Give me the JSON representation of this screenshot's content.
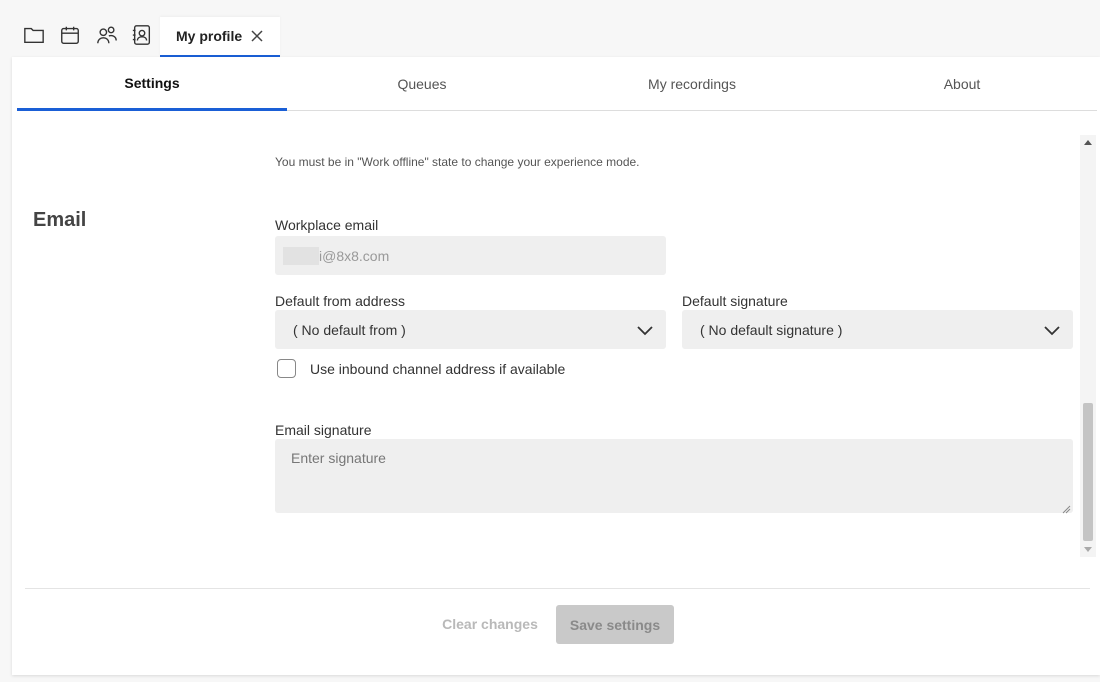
{
  "toolbar": {
    "icons": [
      "folder-icon",
      "calendar-icon",
      "people-icon",
      "contact-book-icon"
    ],
    "active_tab": {
      "label": "My profile",
      "close_icon": "close-icon"
    }
  },
  "tabs": [
    {
      "label": "Settings",
      "active": true
    },
    {
      "label": "Queues",
      "active": false
    },
    {
      "label": "My recordings",
      "active": false
    },
    {
      "label": "About",
      "active": false
    }
  ],
  "settings": {
    "notice": "You must be in \"Work offline\" state to change your experience mode.",
    "email_section": {
      "title": "Email",
      "workplace_email": {
        "label": "Workplace email",
        "value": "i@8x8.com"
      },
      "default_from": {
        "label": "Default from address",
        "value": "( No default from )"
      },
      "default_signature": {
        "label": "Default signature",
        "value": "( No default signature )"
      },
      "inbound_checkbox": {
        "label": "Use inbound channel address if available",
        "checked": false
      },
      "email_signature": {
        "label": "Email signature",
        "placeholder": "Enter signature"
      }
    }
  },
  "footer": {
    "clear_label": "Clear changes",
    "save_label": "Save settings"
  },
  "colors": {
    "accent": "#1a5fd6",
    "field_bg": "#efefef",
    "disabled_button": "#c9c9c9"
  }
}
